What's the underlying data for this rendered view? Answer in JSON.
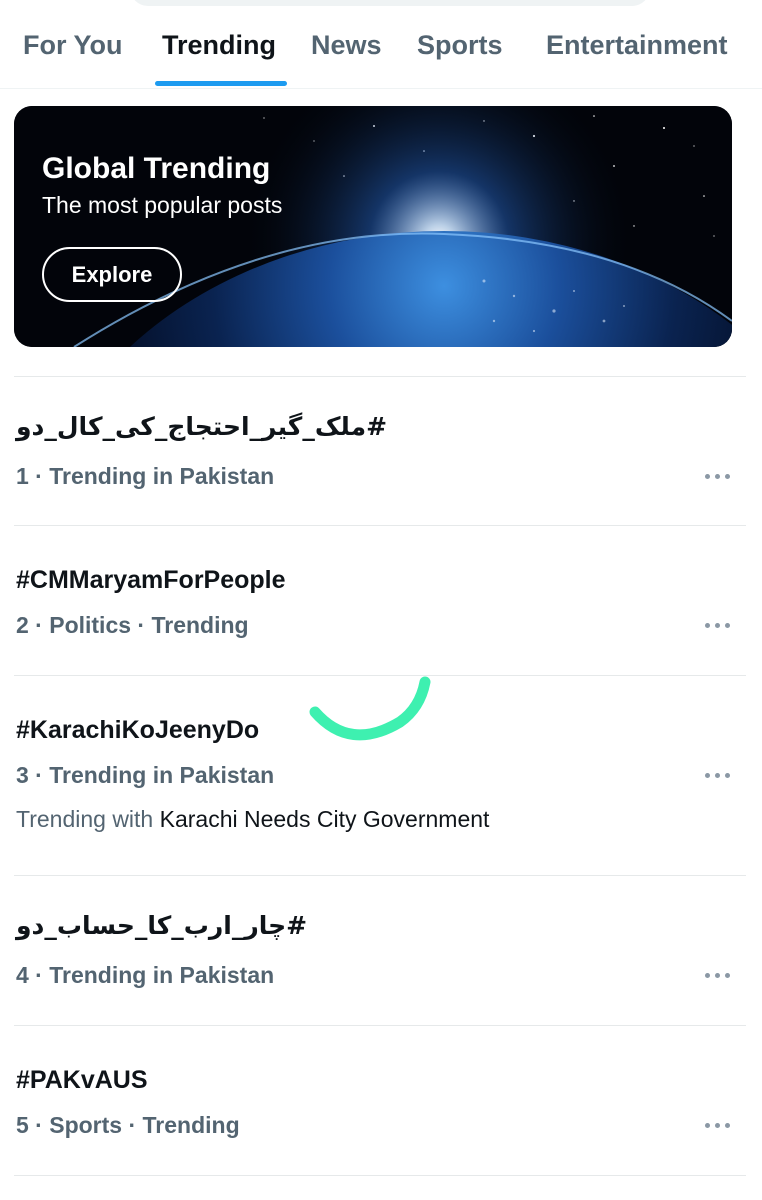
{
  "tabs": [
    {
      "label": "For You",
      "active": false
    },
    {
      "label": "Trending",
      "active": true
    },
    {
      "label": "News",
      "active": false
    },
    {
      "label": "Sports",
      "active": false
    },
    {
      "label": "Entertainment",
      "active": false
    }
  ],
  "banner": {
    "title": "Global Trending",
    "subtitle": "The most popular posts",
    "button_label": "Explore"
  },
  "trends": [
    {
      "name": "#ملک_گیر_احتجاج_کی_کال_دو",
      "meta": "1 · Trending in Pakistan"
    },
    {
      "name": "#CMMaryamForPeople",
      "meta": "2 · Politics · Trending"
    },
    {
      "name": "#KarachiKoJeenyDo",
      "meta": "3 · Trending in Pakistan",
      "with_prefix": "Trending with",
      "with_value": "Karachi Needs City Government"
    },
    {
      "name": "#چار_ارب_کا_حساب_دو",
      "meta": "4 · Trending in Pakistan"
    },
    {
      "name": "#PAKvAUS",
      "meta": "5 · Sports · Trending"
    }
  ],
  "colors": {
    "accent": "#1d9bf0",
    "secondary_text": "#536471",
    "annotation": "#3ef0b0"
  },
  "icons": {
    "more": "more-horizontal-icon"
  }
}
